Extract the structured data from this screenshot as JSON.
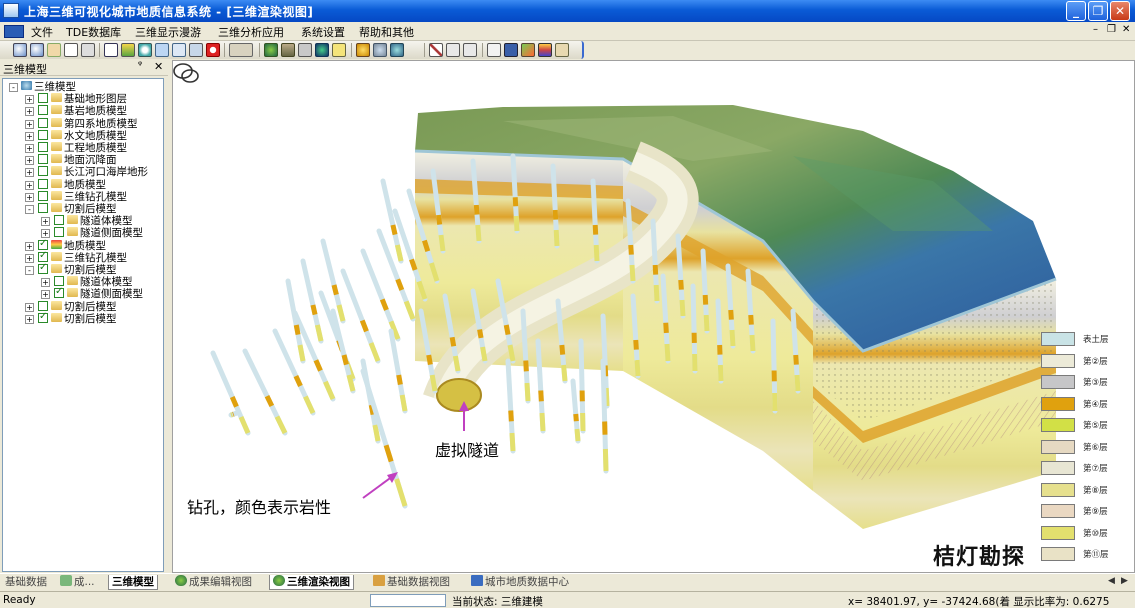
{
  "window": {
    "title": "上海三维可视化城市地质信息系统 - [三维渲染视图]"
  },
  "menu": [
    "文件",
    "TDE数据库",
    "三维显示漫游",
    "三维分析应用",
    "系统设置",
    "帮助和其他"
  ],
  "left_panel": {
    "title": "三维模型",
    "pin_label": "ᵠ",
    "close_label": "✕",
    "tree": [
      {
        "label": "三维模型",
        "level": 0,
        "checked": null,
        "exp": "-",
        "icon": "globe"
      },
      {
        "label": "基础地形图层",
        "level": 1,
        "checked": false,
        "exp": "+",
        "icon": "folder"
      },
      {
        "label": "基岩地质模型",
        "level": 1,
        "checked": false,
        "exp": "+",
        "icon": "folder"
      },
      {
        "label": "第四系地质模型",
        "level": 1,
        "checked": false,
        "exp": "+",
        "icon": "folder"
      },
      {
        "label": "水文地质模型",
        "level": 1,
        "checked": false,
        "exp": "+",
        "icon": "folder"
      },
      {
        "label": "工程地质模型",
        "level": 1,
        "checked": false,
        "exp": "+",
        "icon": "folder"
      },
      {
        "label": "地面沉降面",
        "level": 1,
        "checked": false,
        "exp": "+",
        "icon": "folder"
      },
      {
        "label": "长江河口海岸地形",
        "level": 1,
        "checked": false,
        "exp": "+",
        "icon": "folder"
      },
      {
        "label": "地质模型",
        "level": 1,
        "checked": false,
        "exp": "+",
        "icon": "folder"
      },
      {
        "label": "三维钻孔模型",
        "level": 1,
        "checked": false,
        "exp": "+",
        "icon": "folder"
      },
      {
        "label": "切割后模型",
        "level": 1,
        "checked": false,
        "exp": "-",
        "icon": "folder"
      },
      {
        "label": "隧道体模型",
        "level": 2,
        "checked": false,
        "exp": "+",
        "icon": "folder"
      },
      {
        "label": "隧道侧面模型",
        "level": 2,
        "checked": false,
        "exp": "+",
        "icon": "folder"
      },
      {
        "label": "地质模型",
        "level": 1,
        "checked": true,
        "exp": "+",
        "icon": "layers"
      },
      {
        "label": "三维钻孔模型",
        "level": 1,
        "checked": true,
        "exp": "+",
        "icon": "folder"
      },
      {
        "label": "切割后模型",
        "level": 1,
        "checked": true,
        "exp": "-",
        "icon": "folder"
      },
      {
        "label": "隧道体模型",
        "level": 2,
        "checked": false,
        "exp": "+",
        "icon": "folder"
      },
      {
        "label": "隧道侧面模型",
        "level": 2,
        "checked": true,
        "exp": "+",
        "icon": "folder"
      },
      {
        "label": "切割后模型",
        "level": 1,
        "checked": false,
        "exp": "+",
        "icon": "folder"
      },
      {
        "label": "切割后模型",
        "level": 1,
        "checked": true,
        "exp": "+",
        "icon": "folder"
      }
    ]
  },
  "view": {
    "annotation_tunnel": "虚拟隧道",
    "annotation_borehole": "钻孔，颜色表示岩性",
    "watermark": "桔灯勘探"
  },
  "legend": [
    {
      "label": "表土层",
      "color": "#c9e3e6"
    },
    {
      "label": "第②层",
      "color": "#ecead8"
    },
    {
      "label": "第③层",
      "color": "#c6c6c8"
    },
    {
      "label": "第④层",
      "color": "#e0a10e"
    },
    {
      "label": "第⑤层",
      "color": "#d2e046"
    },
    {
      "label": "第⑥层",
      "color": "#e6d9c2"
    },
    {
      "label": "第⑦层",
      "color": "#e8e6d4"
    },
    {
      "label": "第⑧层",
      "color": "#e6e08e"
    },
    {
      "label": "第⑨层",
      "color": "#ead8c2"
    },
    {
      "label": "第⑩层",
      "color": "#e3e06e"
    },
    {
      "label": "第⑪层",
      "color": "#e9e2c6"
    }
  ],
  "tabs": [
    {
      "label": "基础数据",
      "active": false
    },
    {
      "label": "成...",
      "active": false
    },
    {
      "label": "三维模型",
      "active": true
    },
    {
      "label": "成果编辑视图",
      "active": false
    },
    {
      "label": "三维渲染视图",
      "active": true
    },
    {
      "label": "基础数据视图",
      "active": false
    },
    {
      "label": "城市地质数据中心",
      "active": false
    }
  ],
  "status": {
    "ready": "Ready",
    "state": "当前状态: 三维建模",
    "coords": "x= 38401.97, y= -37424.68(着 显示比率为: 0.6275"
  }
}
